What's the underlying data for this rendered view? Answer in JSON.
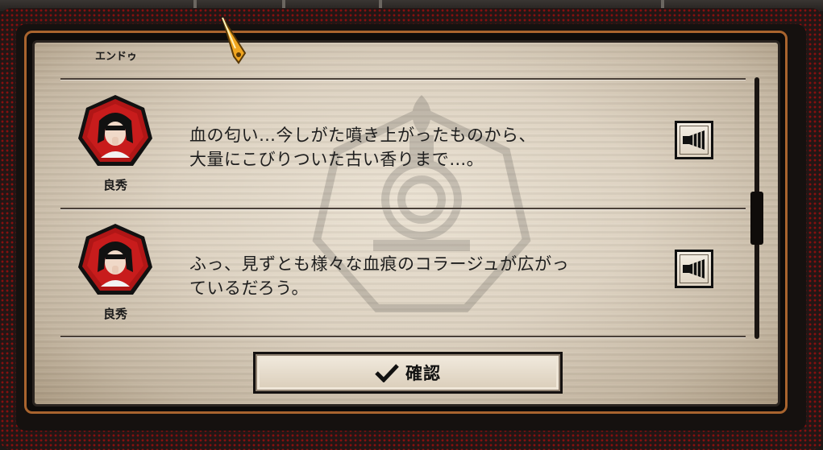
{
  "dialog": {
    "previous_speaker": "エンドゥ",
    "entries": [
      {
        "speaker": "良秀",
        "line1": "血の匂い…今しがた噴き上がったものから、",
        "line2": "大量にこびりついた古い香りまで…。",
        "voice_icon": "speaker-icon"
      },
      {
        "speaker": "良秀",
        "line1": "ふっ、見ずとも様々な血痕のコラージュが広がっ",
        "line2": "ているだろう。",
        "voice_icon": "speaker-icon"
      }
    ],
    "confirm_label": "確認",
    "confirm_icon": "checkmark-icon",
    "scroll_position": 0.55
  },
  "colors": {
    "accent_orange": "#a9642e",
    "paper": "#e2d8c8",
    "frame_red_dots": "#8c0f0f"
  }
}
